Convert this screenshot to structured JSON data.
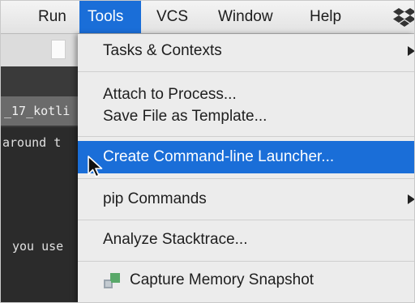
{
  "menubar": {
    "items": [
      {
        "label": "Run"
      },
      {
        "label": "Tools"
      },
      {
        "label": "VCS"
      },
      {
        "label": "Window"
      },
      {
        "label": "Help"
      }
    ],
    "active": "Tools"
  },
  "background": {
    "tab_label": "_17_kotli",
    "code_line_1": "around t",
    "code_line_2": "you use"
  },
  "tools_menu": {
    "items": [
      {
        "label": "Tasks & Contexts",
        "submenu": true
      },
      {
        "label": "Attach to Process...",
        "submenu": false
      },
      {
        "label": "Save File as Template...",
        "submenu": false
      },
      {
        "label": "Create Command-line Launcher...",
        "submenu": false,
        "highlighted": true
      },
      {
        "label": "pip Commands",
        "submenu": true
      },
      {
        "label": "Analyze Stacktrace...",
        "submenu": false
      },
      {
        "label": "Capture Memory Snapshot",
        "submenu": false,
        "icon": "memory-snapshot-icon"
      }
    ]
  },
  "colors": {
    "accent": "#1a6ed8",
    "menu_bg": "#ececec",
    "menubar_bg": "#e8e8e8",
    "ide_dark": "#2b2b2b"
  }
}
